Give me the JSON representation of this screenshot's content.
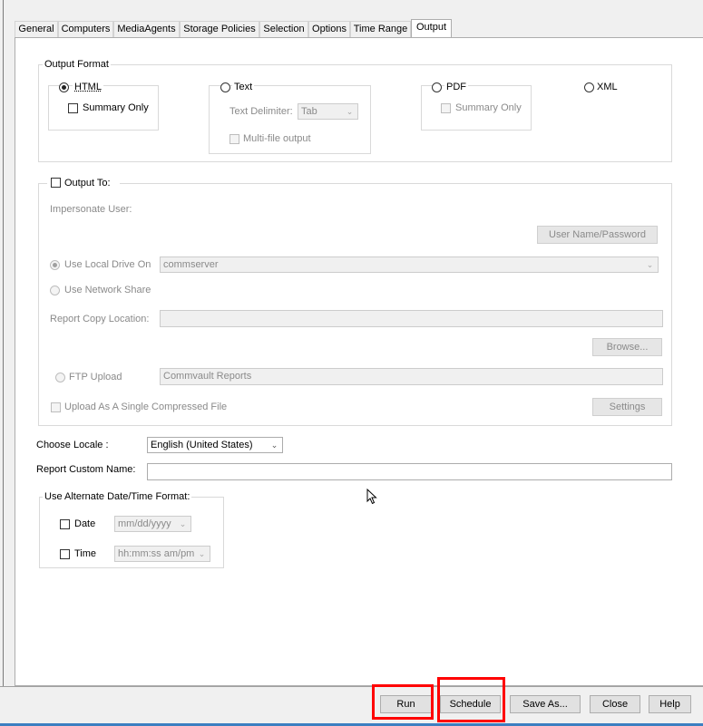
{
  "tabs": [
    {
      "label": "General",
      "active": false
    },
    {
      "label": "Computers",
      "active": false
    },
    {
      "label": "MediaAgents",
      "active": false
    },
    {
      "label": "Storage Policies",
      "active": false
    },
    {
      "label": "Selection",
      "active": false
    },
    {
      "label": "Options",
      "active": false
    },
    {
      "label": "Time Range",
      "active": false
    },
    {
      "label": "Output",
      "active": true
    }
  ],
  "output_format": {
    "legend": "Output Format",
    "html": {
      "label": "HTML",
      "selected": true
    },
    "summary_only": {
      "label": "Summary Only",
      "checked": false
    },
    "text": {
      "label": "Text",
      "selected": false
    },
    "text_delimiter": {
      "label": "Text Delimiter:",
      "value": "Tab"
    },
    "multi_file": {
      "label": "Multi-file output",
      "checked": false
    },
    "pdf": {
      "label": "PDF",
      "selected": false
    },
    "pdf_summary_only": {
      "label": "Summary Only",
      "checked": false
    },
    "xml": {
      "label": "XML",
      "selected": false
    }
  },
  "output_to": {
    "label": "Output To:",
    "checked": false,
    "impersonate_user": "Impersonate User:",
    "user_name_password_button": "User Name/Password",
    "use_local_drive": {
      "label": "Use Local Drive On",
      "selected": true,
      "value": "commserver"
    },
    "use_network_share": {
      "label": "Use Network Share",
      "selected": false
    },
    "report_copy_location": {
      "label": "Report Copy Location:",
      "value": ""
    },
    "browse_button": "Browse...",
    "ftp_upload": {
      "label": "FTP Upload",
      "selected": false,
      "value": "Commvault Reports"
    },
    "single_compressed": {
      "label": "Upload As A Single Compressed File",
      "checked": false
    },
    "settings_button": "Settings"
  },
  "locale": {
    "label": "Choose Locale :",
    "value": "English (United States)"
  },
  "report_custom_name": {
    "label": "Report Custom Name:",
    "value": ""
  },
  "alt_datetime": {
    "legend": "Use Alternate Date/Time Format:",
    "date": {
      "label": "Date",
      "checked": false,
      "format": "mm/dd/yyyy"
    },
    "time": {
      "label": "Time",
      "checked": false,
      "format": "hh:mm:ss am/pm"
    }
  },
  "buttons": {
    "run": "Run",
    "schedule": "Schedule",
    "save_as": "Save As...",
    "close": "Close",
    "help": "Help"
  },
  "colors": {
    "highlight": "#ff0000",
    "taskbar_accent": "#3c7fc1"
  }
}
